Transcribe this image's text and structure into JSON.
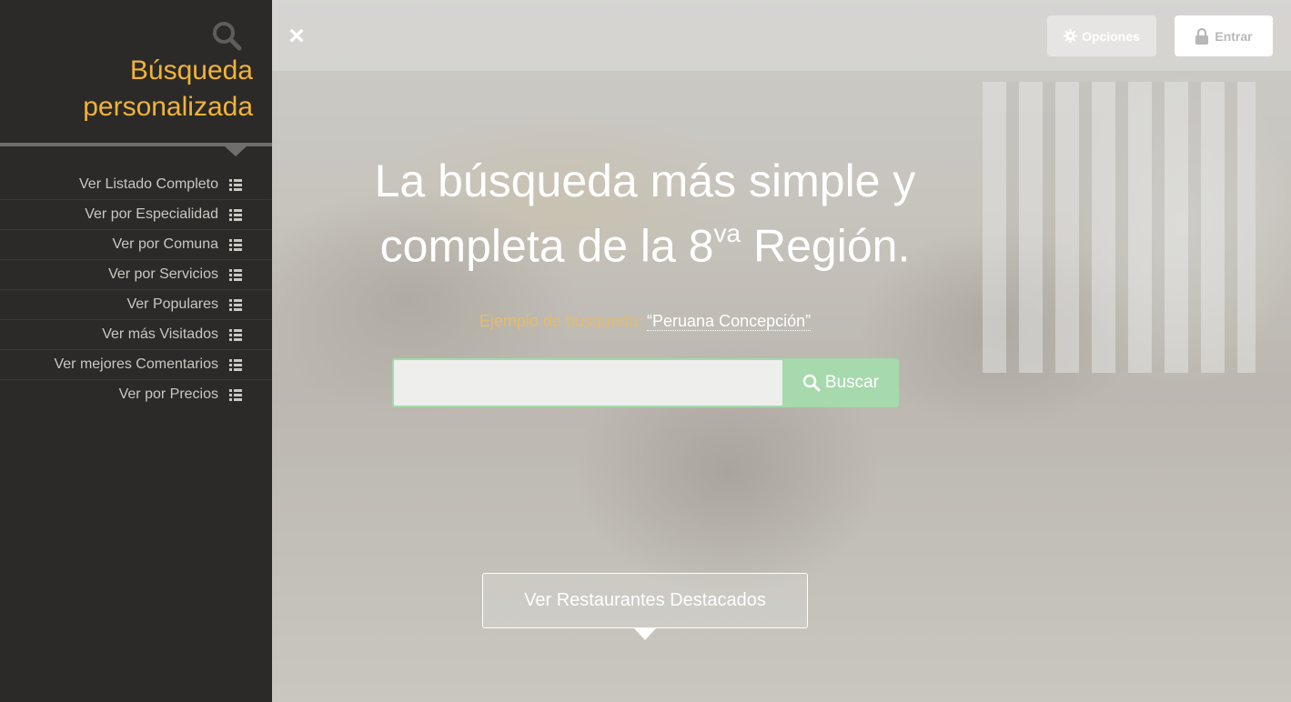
{
  "topbar": {
    "close_label": "×",
    "options_label": "Opciones",
    "enter_label": "Entrar"
  },
  "sidebar": {
    "title_line1": "Búsqueda",
    "title_line2": "personalizada",
    "items": [
      {
        "label": "Ver Listado Completo"
      },
      {
        "label": "Ver por Especialidad"
      },
      {
        "label": "Ver por Comuna"
      },
      {
        "label": "Ver por Servicios"
      },
      {
        "label": "Ver Populares"
      },
      {
        "label": "Ver más Visitados"
      },
      {
        "label": "Ver mejores Comentarios"
      },
      {
        "label": "Ver por Precios"
      }
    ]
  },
  "hero": {
    "headline_line1": "La búsqueda más simple y",
    "headline_line2_pre": "completa de la 8",
    "headline_sup": "va",
    "headline_line2_post": " Región.",
    "example_label": "Ejemplo de búsqueda:",
    "example_value": "“Peruana Concepción”",
    "search_value": "",
    "search_placeholder": "",
    "search_button": "Buscar",
    "featured_button": "Ver Restaurantes Destacados"
  },
  "colors": {
    "sidebar_bg": "#2b2a28",
    "accent": "#f1b33a",
    "search_green": "#a6d9ab"
  },
  "icons": [
    "search-icon",
    "close-icon",
    "gear-icon",
    "lock-icon",
    "list-icon"
  ]
}
